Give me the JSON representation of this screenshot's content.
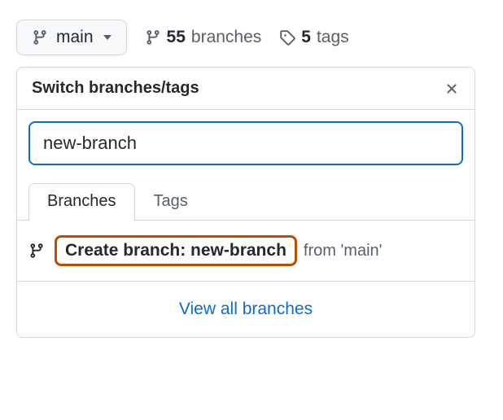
{
  "branchSelector": {
    "currentBranch": "main"
  },
  "stats": {
    "branchesCount": "55",
    "branchesLabel": "branches",
    "tagsCount": "5",
    "tagsLabel": "tags"
  },
  "popover": {
    "title": "Switch branches/tags",
    "searchValue": "new-branch",
    "tabs": {
      "branches": "Branches",
      "tags": "Tags"
    },
    "createRow": {
      "label": "Create branch: new-branch",
      "fromText": "from 'main'"
    },
    "viewAll": "View all branches"
  }
}
